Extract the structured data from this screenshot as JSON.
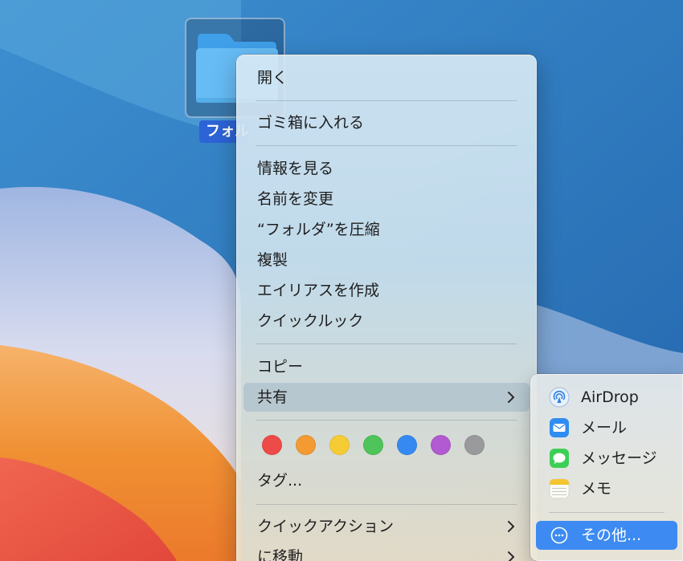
{
  "desktop": {
    "folder_label": "フォルダ"
  },
  "context_menu": {
    "open": "開く",
    "trash": "ゴミ箱に入れる",
    "get_info": "情報を見る",
    "rename": "名前を変更",
    "compress": "“フォルダ”を圧縮",
    "duplicate": "複製",
    "make_alias": "エイリアスを作成",
    "quick_look": "クイックルック",
    "copy": "コピー",
    "share": "共有",
    "tags_label": "タグ...",
    "quick_actions": "クイックアクション",
    "move_to": "に移動",
    "tag_colors": [
      {
        "name": "red",
        "color": "#ee4b48"
      },
      {
        "name": "orange",
        "color": "#f39a33"
      },
      {
        "name": "yellow",
        "color": "#f6cc35"
      },
      {
        "name": "green",
        "color": "#4ec45a"
      },
      {
        "name": "blue",
        "color": "#3589f1"
      },
      {
        "name": "purple",
        "color": "#b25ad1"
      },
      {
        "name": "gray",
        "color": "#9a9a9c"
      }
    ]
  },
  "share_submenu": {
    "items": [
      {
        "label": "AirDrop",
        "icon": "airdrop-icon"
      },
      {
        "label": "メール",
        "icon": "mail-icon"
      },
      {
        "label": "メッセージ",
        "icon": "messages-icon"
      },
      {
        "label": "メモ",
        "icon": "notes-icon"
      }
    ],
    "more": {
      "label": "その他...",
      "icon": "more-icon"
    }
  },
  "colors": {
    "selection_blue": "#3d8bf2",
    "label_blue": "#2c63d6"
  }
}
